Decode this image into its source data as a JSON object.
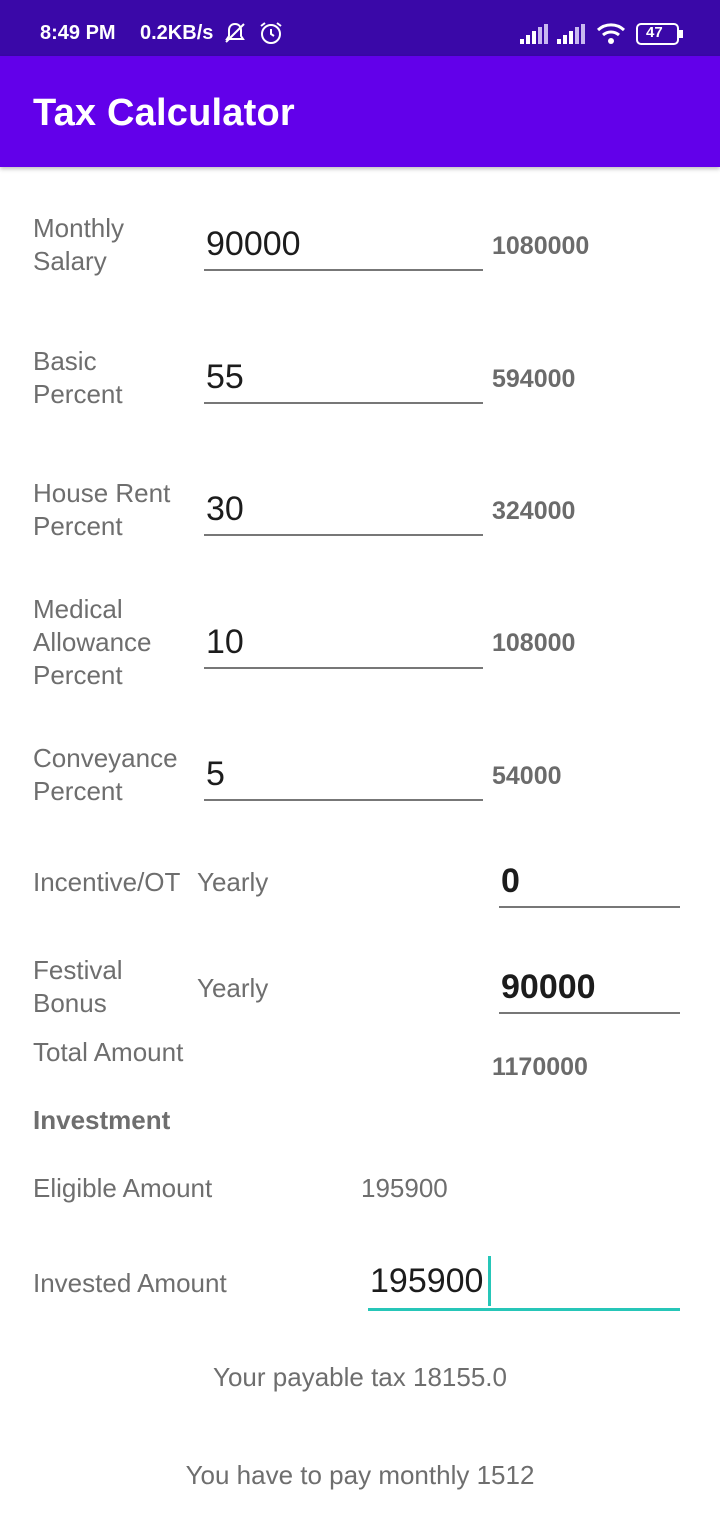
{
  "status_bar": {
    "time": "8:49 PM",
    "speed": "0.2KB/s",
    "battery": "47",
    "icons": [
      "mute-notifications-icon",
      "alarm-icon",
      "signal-icon",
      "signal-icon",
      "wifi-icon",
      "battery-icon"
    ]
  },
  "app_bar": {
    "title": "Tax Calculator"
  },
  "rows": [
    {
      "label_lines": [
        "Monthly",
        "Salary"
      ],
      "value": "90000",
      "result": "1080000"
    },
    {
      "label_lines": [
        "Basic",
        "Percent"
      ],
      "value": "55",
      "result": "594000"
    },
    {
      "label_lines": [
        "House Rent",
        "Percent"
      ],
      "value": "30",
      "result": "324000"
    },
    {
      "label_lines": [
        "Medical",
        "Allowance",
        "Percent"
      ],
      "value": "10",
      "result": "108000"
    },
    {
      "label_lines": [
        "Conveyance",
        "Percent"
      ],
      "value": "5",
      "result": "54000"
    }
  ],
  "incentive": {
    "label": "Incentive/OT",
    "period": "Yearly",
    "value": "0"
  },
  "festival": {
    "label_lines": [
      "Festival",
      "Bonus"
    ],
    "period": "Yearly",
    "value": "90000"
  },
  "total": {
    "label": "Total Amount",
    "value": "1170000"
  },
  "investment": {
    "heading": "Investment",
    "eligible_label": "Eligible Amount",
    "eligible_value": "195900",
    "invested_label": "Invested Amount",
    "invested_value": "195900"
  },
  "payable_tax_text": "Your payable tax 18155.0",
  "monthly_text": "You have to pay monthly 1512",
  "colors": {
    "status_bar": "#3a08a8",
    "app_bar": "#6200ea",
    "accent": "#26c6b8"
  }
}
